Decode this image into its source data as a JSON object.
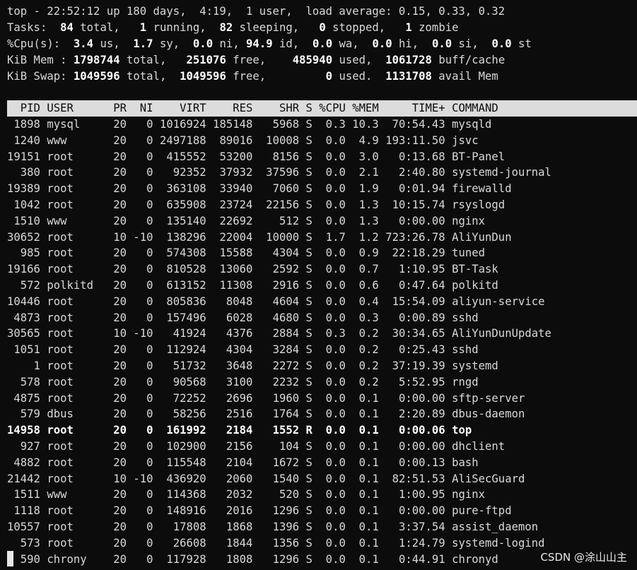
{
  "summary": {
    "line1": "top - 22:52:12 up 180 days,  4:19,  1 user,  load average: 0.15, 0.33, 0.32",
    "tasks": {
      "label": "Tasks:",
      "total": "84",
      "total_lbl": " total,",
      "running": "1",
      "running_lbl": " running,",
      "sleeping": "82",
      "sleeping_lbl": " sleeping,",
      "stopped": "0",
      "stopped_lbl": " stopped,",
      "zombie": "1",
      "zombie_lbl": " zombie"
    },
    "cpu": {
      "label": "%Cpu(s):",
      "us": "3.4",
      "us_lbl": " us,",
      "sy": "1.7",
      "sy_lbl": " sy,",
      "ni": "0.0",
      "ni_lbl": " ni,",
      "id": "94.9",
      "id_lbl": " id,",
      "wa": "0.0",
      "wa_lbl": " wa,",
      "hi": "0.0",
      "hi_lbl": " hi,",
      "si": "0.0",
      "si_lbl": " si,",
      "st": "0.0",
      "st_lbl": " st"
    },
    "mem": {
      "label": "KiB Mem :",
      "total": "1798744",
      "total_lbl": " total,",
      "free": "251076",
      "free_lbl": " free,",
      "used": "485940",
      "used_lbl": " used,",
      "cache": "1061728",
      "cache_lbl": " buff/cache"
    },
    "swap": {
      "label": "KiB Swap:",
      "total": "1049596",
      "total_lbl": " total,",
      "free": "1049596",
      "free_lbl": " free,",
      "used": "0",
      "used_lbl": " used.",
      "avail": "1131708",
      "avail_lbl": " avail Mem"
    }
  },
  "columns": [
    "PID",
    "USER",
    "PR",
    "NI",
    "VIRT",
    "RES",
    "SHR",
    "S",
    "%CPU",
    "%MEM",
    "TIME+",
    "COMMAND"
  ],
  "processes": [
    [
      "1898",
      "mysql",
      "20",
      "0",
      "1016924",
      "185148",
      "5968",
      "S",
      "0.3",
      "10.3",
      "70:54.43",
      "mysqld"
    ],
    [
      "1240",
      "www",
      "20",
      "0",
      "2497188",
      "89016",
      "10008",
      "S",
      "0.0",
      "4.9",
      "193:11.50",
      "jsvc"
    ],
    [
      "19151",
      "root",
      "20",
      "0",
      "415552",
      "53200",
      "8156",
      "S",
      "0.0",
      "3.0",
      "0:13.68",
      "BT-Panel"
    ],
    [
      "380",
      "root",
      "20",
      "0",
      "92352",
      "37932",
      "37596",
      "S",
      "0.0",
      "2.1",
      "2:40.80",
      "systemd-journal"
    ],
    [
      "19389",
      "root",
      "20",
      "0",
      "363108",
      "33940",
      "7060",
      "S",
      "0.0",
      "1.9",
      "0:01.94",
      "firewalld"
    ],
    [
      "1042",
      "root",
      "20",
      "0",
      "635908",
      "23724",
      "22156",
      "S",
      "0.0",
      "1.3",
      "10:15.74",
      "rsyslogd"
    ],
    [
      "1510",
      "www",
      "20",
      "0",
      "135140",
      "22692",
      "512",
      "S",
      "0.0",
      "1.3",
      "0:00.00",
      "nginx"
    ],
    [
      "30652",
      "root",
      "10",
      "-10",
      "138296",
      "22004",
      "10000",
      "S",
      "1.7",
      "1.2",
      "723:26.78",
      "AliYunDun"
    ],
    [
      "985",
      "root",
      "20",
      "0",
      "574308",
      "15588",
      "4304",
      "S",
      "0.0",
      "0.9",
      "22:18.29",
      "tuned"
    ],
    [
      "19166",
      "root",
      "20",
      "0",
      "810528",
      "13060",
      "2592",
      "S",
      "0.0",
      "0.7",
      "1:10.95",
      "BT-Task"
    ],
    [
      "572",
      "polkitd",
      "20",
      "0",
      "613152",
      "11308",
      "2916",
      "S",
      "0.0",
      "0.6",
      "0:47.64",
      "polkitd"
    ],
    [
      "10446",
      "root",
      "20",
      "0",
      "805836",
      "8048",
      "4604",
      "S",
      "0.0",
      "0.4",
      "15:54.09",
      "aliyun-service"
    ],
    [
      "4873",
      "root",
      "20",
      "0",
      "157496",
      "6028",
      "4680",
      "S",
      "0.0",
      "0.3",
      "0:00.89",
      "sshd"
    ],
    [
      "30565",
      "root",
      "10",
      "-10",
      "41924",
      "4376",
      "2884",
      "S",
      "0.3",
      "0.2",
      "30:34.65",
      "AliYunDunUpdate"
    ],
    [
      "1051",
      "root",
      "20",
      "0",
      "112924",
      "4304",
      "3284",
      "S",
      "0.0",
      "0.2",
      "0:25.43",
      "sshd"
    ],
    [
      "1",
      "root",
      "20",
      "0",
      "51732",
      "3648",
      "2272",
      "S",
      "0.0",
      "0.2",
      "37:19.39",
      "systemd"
    ],
    [
      "578",
      "root",
      "20",
      "0",
      "90568",
      "3100",
      "2232",
      "S",
      "0.0",
      "0.2",
      "5:52.95",
      "rngd"
    ],
    [
      "4875",
      "root",
      "20",
      "0",
      "72252",
      "2696",
      "1960",
      "S",
      "0.0",
      "0.1",
      "0:00.00",
      "sftp-server"
    ],
    [
      "579",
      "dbus",
      "20",
      "0",
      "58256",
      "2516",
      "1764",
      "S",
      "0.0",
      "0.1",
      "2:20.89",
      "dbus-daemon"
    ],
    [
      "14958",
      "root",
      "20",
      "0",
      "161992",
      "2184",
      "1552",
      "R",
      "0.0",
      "0.1",
      "0:00.06",
      "top"
    ],
    [
      "927",
      "root",
      "20",
      "0",
      "102900",
      "2156",
      "104",
      "S",
      "0.0",
      "0.1",
      "0:00.00",
      "dhclient"
    ],
    [
      "4882",
      "root",
      "20",
      "0",
      "115548",
      "2104",
      "1672",
      "S",
      "0.0",
      "0.1",
      "0:00.13",
      "bash"
    ],
    [
      "21442",
      "root",
      "10",
      "-10",
      "436920",
      "2060",
      "1540",
      "S",
      "0.0",
      "0.1",
      "82:51.53",
      "AliSecGuard"
    ],
    [
      "1511",
      "www",
      "20",
      "0",
      "114368",
      "2032",
      "520",
      "S",
      "0.0",
      "0.1",
      "1:00.95",
      "nginx"
    ],
    [
      "1118",
      "root",
      "20",
      "0",
      "148916",
      "2016",
      "1296",
      "S",
      "0.0",
      "0.1",
      "0:00.00",
      "pure-ftpd"
    ],
    [
      "10557",
      "root",
      "20",
      "0",
      "17808",
      "1868",
      "1396",
      "S",
      "0.0",
      "0.1",
      "3:37.54",
      "assist_daemon"
    ],
    [
      "573",
      "root",
      "20",
      "0",
      "26608",
      "1844",
      "1356",
      "S",
      "0.0",
      "0.1",
      "1:24.79",
      "systemd-logind"
    ],
    [
      "590",
      "chrony",
      "20",
      "0",
      "117928",
      "1808",
      "1296",
      "S",
      "0.0",
      "0.1",
      "0:44.91",
      "chronyd"
    ]
  ],
  "highlight_pid": "14958",
  "watermark": "CSDN @涂山山主"
}
